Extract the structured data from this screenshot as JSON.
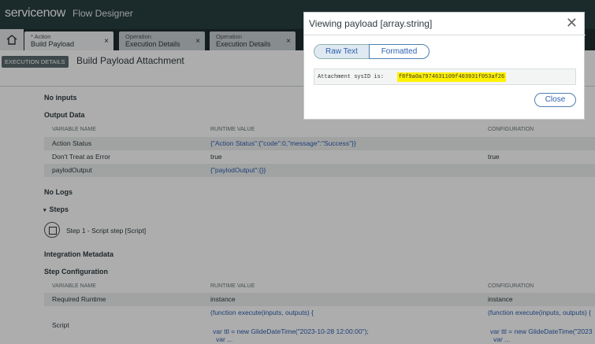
{
  "app": {
    "brand": "servicenow",
    "product": "Flow Designer"
  },
  "tabs": [
    {
      "line1": "* Action",
      "line2": "Build Payload",
      "close": "×"
    },
    {
      "line1": "Operation",
      "line2": "Execution Details",
      "close": "×"
    },
    {
      "line1": "Operation",
      "line2": "Execution Details",
      "close": "×"
    }
  ],
  "header": {
    "badge": "EXECUTION DETAILS",
    "title": "Build Payload Attachment"
  },
  "sections": {
    "no_inputs": "No inputs",
    "output_data": "Output Data",
    "no_logs": "No Logs",
    "steps": "Steps",
    "integration_metadata": "Integration Metadata",
    "step_configuration": "Step Configuration"
  },
  "columns": {
    "variable_name": "VARIABLE NAME",
    "runtime_value": "RUNTIME VALUE",
    "configuration": "CONFIGURATION"
  },
  "output_rows": [
    {
      "name": "Action Status",
      "value": "{\"Action Status\":{\"code\":0,\"message\":\"Success\"}}",
      "config": ""
    },
    {
      "name": "Don't Treat as Error",
      "value": "true",
      "config": "true"
    },
    {
      "name": "paylodOutput",
      "value": "{\"paylodOutput\":{}}",
      "config": ""
    }
  ],
  "step": {
    "label": "Step 1 - Script step [Script]"
  },
  "config_rows": [
    {
      "name": "Required Runtime",
      "value": "instance",
      "config": "instance"
    },
    {
      "name": "Script",
      "value_lines": [
        "(function execute(inputs, outputs) {",
        "",
        "var ttl = new GlideDateTime(\"2023-10-28 12:00:00\");",
        "var ..."
      ],
      "config_lines": [
        "(function execute(inputs, outputs) {",
        "",
        "var ttl = new GlideDateTime(\"2023",
        "var ..."
      ]
    }
  ],
  "modal": {
    "title": "Viewing payload [array.string]",
    "raw_text": "Raw Text",
    "formatted": "Formatted",
    "payload_prefix": "Attachment sysID is:",
    "payload_value": "f8f9a0a7974631109f403931f053af26",
    "close_button": "Close"
  },
  "colors": {
    "header_bg": "#293e40",
    "accent": "#2d5fb0",
    "highlight": "#fff200"
  }
}
